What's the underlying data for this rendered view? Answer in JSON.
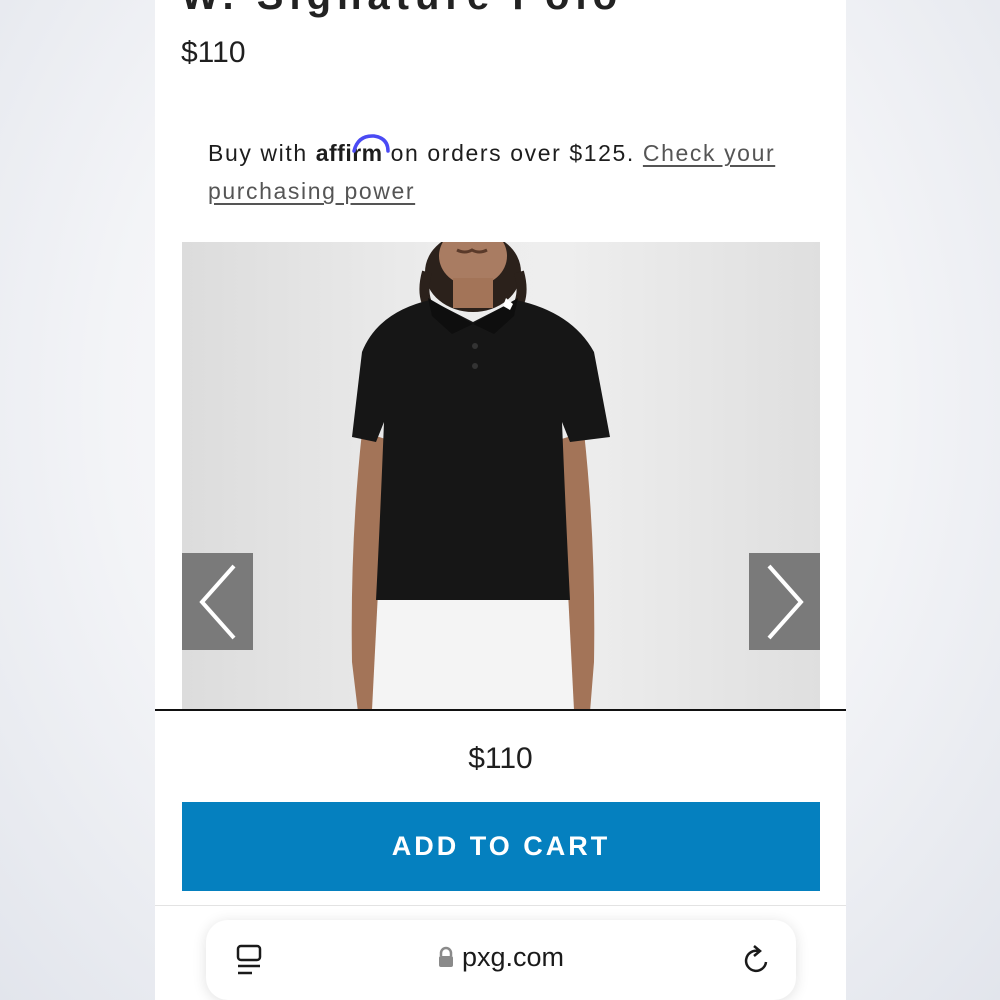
{
  "product": {
    "title_partial": "W. Signature Polo",
    "price": "$110"
  },
  "affirm": {
    "prefix": "Buy with",
    "logo": "affirm",
    "middle": "on orders over $125.",
    "link": "Check your purchasing power"
  },
  "gallery": {
    "prev_icon": "chevron-left-icon",
    "next_icon": "chevron-right-icon"
  },
  "sticky_bar": {
    "price": "$110",
    "button_label": "ADD TO CART"
  },
  "browser": {
    "domain": "pxg.com",
    "tabs_icon": "tabs-icon",
    "lock_icon": "lock-icon",
    "reload_icon": "reload-icon"
  },
  "colors": {
    "cart_button": "#0580bf",
    "affirm_arc": "#4a4af4",
    "arrow_bg": "#7a7a7a"
  }
}
